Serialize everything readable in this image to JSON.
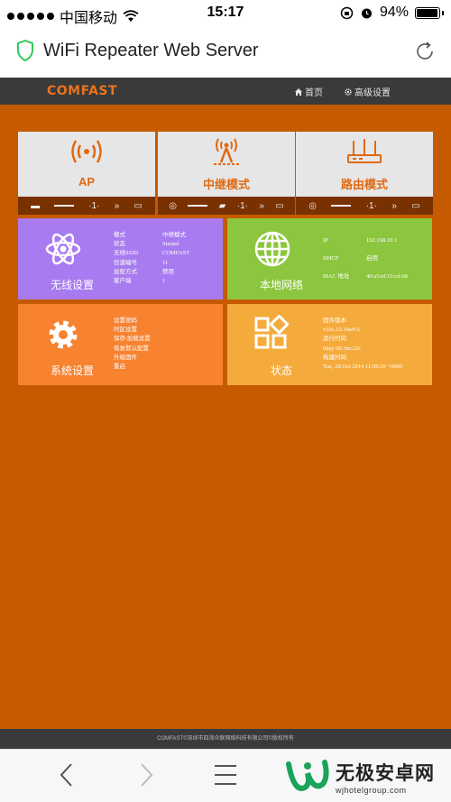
{
  "status_bar": {
    "carrier": "中国移动",
    "time": "15:17",
    "battery": "94%"
  },
  "browser": {
    "page_title": "WiFi Repeater Web Server"
  },
  "nav": {
    "logo": "COMFAST",
    "home": "首页",
    "advanced": "高级设置"
  },
  "modes": [
    {
      "label": "AP",
      "icon": "wireless-signal-icon"
    },
    {
      "label": "中继模式",
      "icon": "repeater-tower-icon"
    },
    {
      "label": "路由模式",
      "icon": "router-icon"
    }
  ],
  "wireless": {
    "title": "无线设置",
    "rows": [
      {
        "k": "模式",
        "v": "中继模式"
      },
      {
        "k": "状态",
        "v": "Started"
      },
      {
        "k": "无线SSID",
        "v": "COMFAST"
      },
      {
        "k": "信道编号",
        "v": "11"
      },
      {
        "k": "加密方式",
        "v": "禁用"
      },
      {
        "k": "客户端",
        "v": "1"
      }
    ]
  },
  "lan": {
    "title": "本地网络",
    "rows": [
      {
        "k": "IP",
        "v": "192.168.10.1"
      },
      {
        "k": "DHCP",
        "v": "启用"
      },
      {
        "k": "MAC 地址",
        "v": "40:a5:ef:15:cd:68"
      }
    ]
  },
  "system": {
    "title": "系统设置",
    "items": [
      "设置密码",
      "时区设置",
      "保存/加载设置",
      "恢复默认配置",
      "升级固件",
      "重启"
    ]
  },
  "status": {
    "title": "状态",
    "items": [
      "固件版本",
      "v16c.12.10aNA",
      "运行时间",
      "0day 0h:3m:22s",
      "构建时间",
      "Tue, 28 Oct 2014 11:09:20 +0800"
    ]
  },
  "footer": {
    "text": "COMFAST©深圳市四海众联网络科技有限公司©版权所有"
  },
  "watermark": {
    "name": "无极安卓网",
    "url": "wjhotelgroup.com"
  },
  "colors": {
    "accent": "#e06a12",
    "background": "#c55a00",
    "wireless": "#a87cf0",
    "lan": "#8cc63f",
    "system": "#f78230",
    "status": "#f5ab3c"
  }
}
